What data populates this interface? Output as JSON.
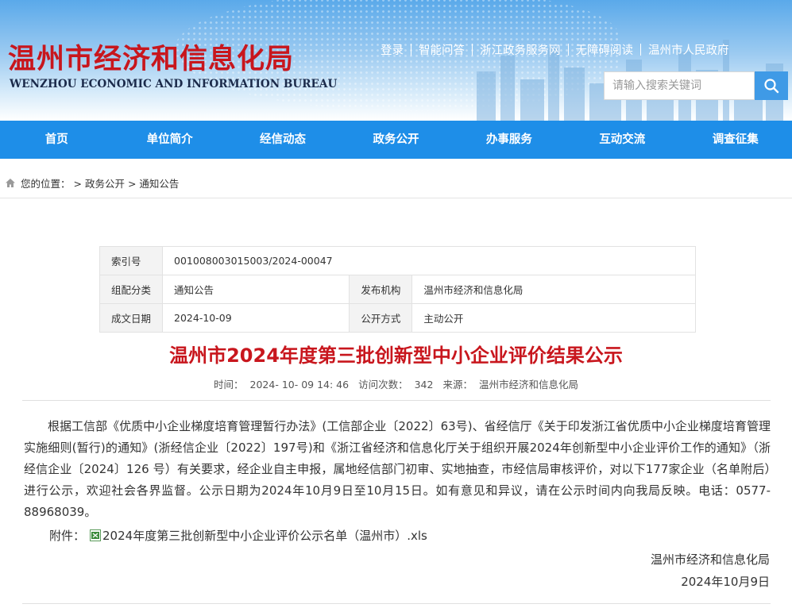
{
  "header": {
    "logo_cn": "温州市经济和信息化局",
    "logo_en": "WENZHOU ECONOMIC AND INFORMATION BUREAU",
    "links": [
      "登录",
      "智能问答",
      "浙江政务服务网",
      "无障碍阅读",
      "温州市人民政府"
    ],
    "search_placeholder": "请输入搜索关键词"
  },
  "nav": [
    "首页",
    "单位简介",
    "经信动态",
    "政务公开",
    "办事服务",
    "互动交流",
    "调查征集"
  ],
  "breadcrumb": {
    "label": "您的位置：",
    "items": [
      "> 政务公开",
      "> 通知公告"
    ]
  },
  "meta": {
    "index_label": "索引号",
    "index_value": "001008003015003/2024-00047",
    "category_label": "组配分类",
    "category_value": "通知公告",
    "publisher_label": "发布机构",
    "publisher_value": "温州市经济和信息化局",
    "date_label": "成文日期",
    "date_value": "2024-10-09",
    "mode_label": "公开方式",
    "mode_value": "主动公开"
  },
  "article": {
    "title": "温州市2024年度第三批创新型中小企业评价结果公示",
    "time_label": "时间：",
    "time_value": "2024- 10- 09 14: 46",
    "visits_label": "访问次数：",
    "visits_value": "342",
    "source_label": "来源：",
    "source_value": "温州市经济和信息化局",
    "body": "根据工信部《优质中小企业梯度培育管理暂行办法》(工信部企业〔2022〕63号)、省经信厅《关于印发浙江省优质中小企业梯度培育管理实施细则(暂行)的通知》(浙经信企业〔2022〕197号)和《浙江省经济和信息化厅关于组织开展2024年创新型中小企业评价工作的通知》（浙经信企业〔2024〕126 号）有关要求，经企业自主申报，属地经信部门初审、实地抽查，市经信局审核评价，对以下177家企业（名单附后）进行公示，欢迎社会各界监督。公示日期为2024年10月9日至10月15日。如有意见和异议，请在公示时间内向我局反映。电话：0577-88968039。",
    "attach_label": "附件：",
    "attach_file": "2024年度第三批创新型中小企业评价公示名单（温州市）.xls",
    "sign_org": "温州市经济和信息化局",
    "sign_date": "2024年10月9日"
  },
  "colors": {
    "nav": "#1e8ee8",
    "title": "#c8161d",
    "logo": "#c8161d",
    "search_button": "#3f9ae6"
  },
  "icons": {
    "search": "search-icon",
    "home": "home-icon",
    "attachment": "excel-file-icon"
  }
}
